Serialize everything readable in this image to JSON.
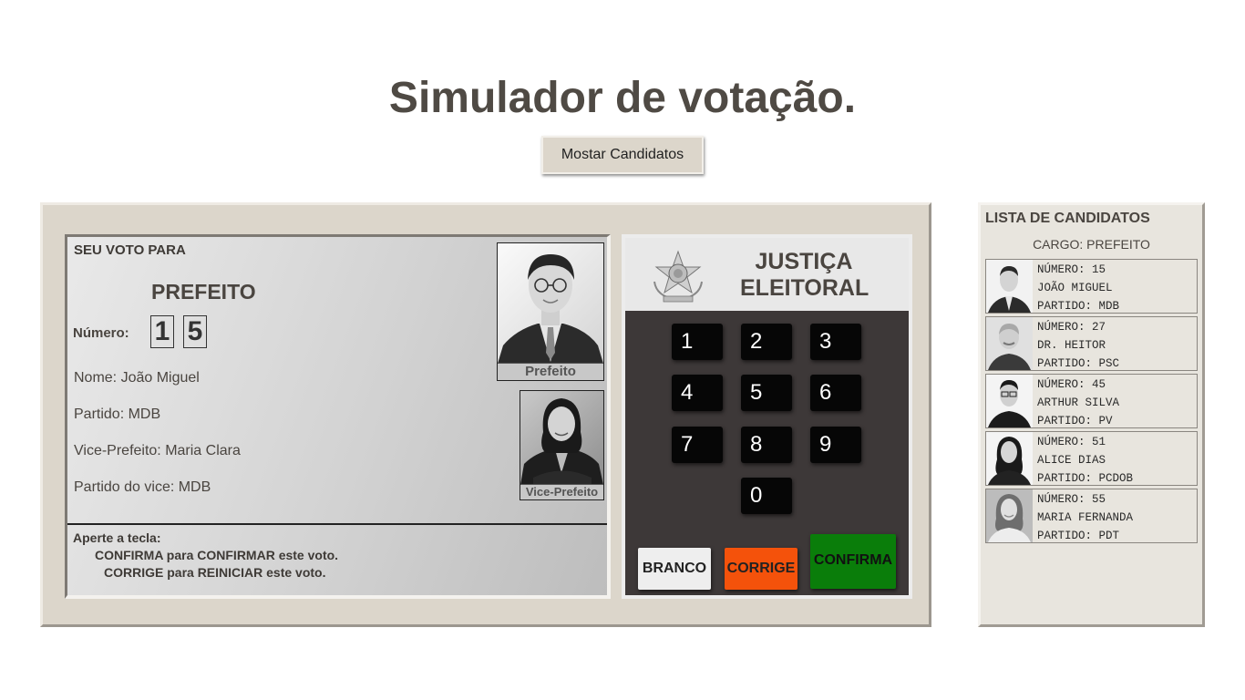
{
  "header": {
    "title": "Simulador de votação.",
    "show_candidates_button": "Mostar Candidatos"
  },
  "screen": {
    "vote_label": "SEU VOTO PARA",
    "office": "PREFEITO",
    "number_label": "Número:",
    "digits": [
      "1",
      "5"
    ],
    "name": "Nome: João Miguel",
    "party": "Partido: MDB",
    "vice": "Vice-Prefeito: Maria Clara",
    "vice_party": "Partido do vice: MDB",
    "stray_mark": ",",
    "photo_main_caption": "Prefeito",
    "photo_vice_caption": "Vice-Prefeito",
    "instructions": {
      "line1": "Aperte a tecla:",
      "line2": "CONFIRMA para CONFIRMAR este voto.",
      "line3": "CORRIGE para REINICIAR este voto."
    }
  },
  "keypad": {
    "header_line1": "JUSTIÇA",
    "header_line2": "ELEITORAL",
    "keys": [
      "1",
      "2",
      "3",
      "4",
      "5",
      "6",
      "7",
      "8",
      "9",
      "0"
    ],
    "branco": "BRANCO",
    "corrige": "CORRIGE",
    "confirma": "CONFIRMA",
    "colors": {
      "branco": "#eeeeee",
      "corrige": "#f4520b",
      "confirma": "#0a7d0a",
      "key": "#060606",
      "panel": "#3d3838"
    }
  },
  "candidate_list": {
    "title": "LISTA DE CANDIDATOS",
    "cargo": "CARGO: PREFEITO",
    "candidates": [
      {
        "numero": "NÚMERO: 15",
        "nome": "JOÃO MIGUEL",
        "partido": "PARTIDO: MDB"
      },
      {
        "numero": "NÚMERO: 27",
        "nome": "DR. HEITOR",
        "partido": "PARTIDO: PSC"
      },
      {
        "numero": "NÚMERO: 45",
        "nome": "ARTHUR SILVA",
        "partido": "PARTIDO: PV"
      },
      {
        "numero": "NÚMERO: 51",
        "nome": "ALICE DIAS",
        "partido": "PARTIDO: PCDOB"
      },
      {
        "numero": "NÚMERO: 55",
        "nome": "MARIA FERNANDA",
        "partido": "PARTIDO: PDT"
      }
    ]
  }
}
